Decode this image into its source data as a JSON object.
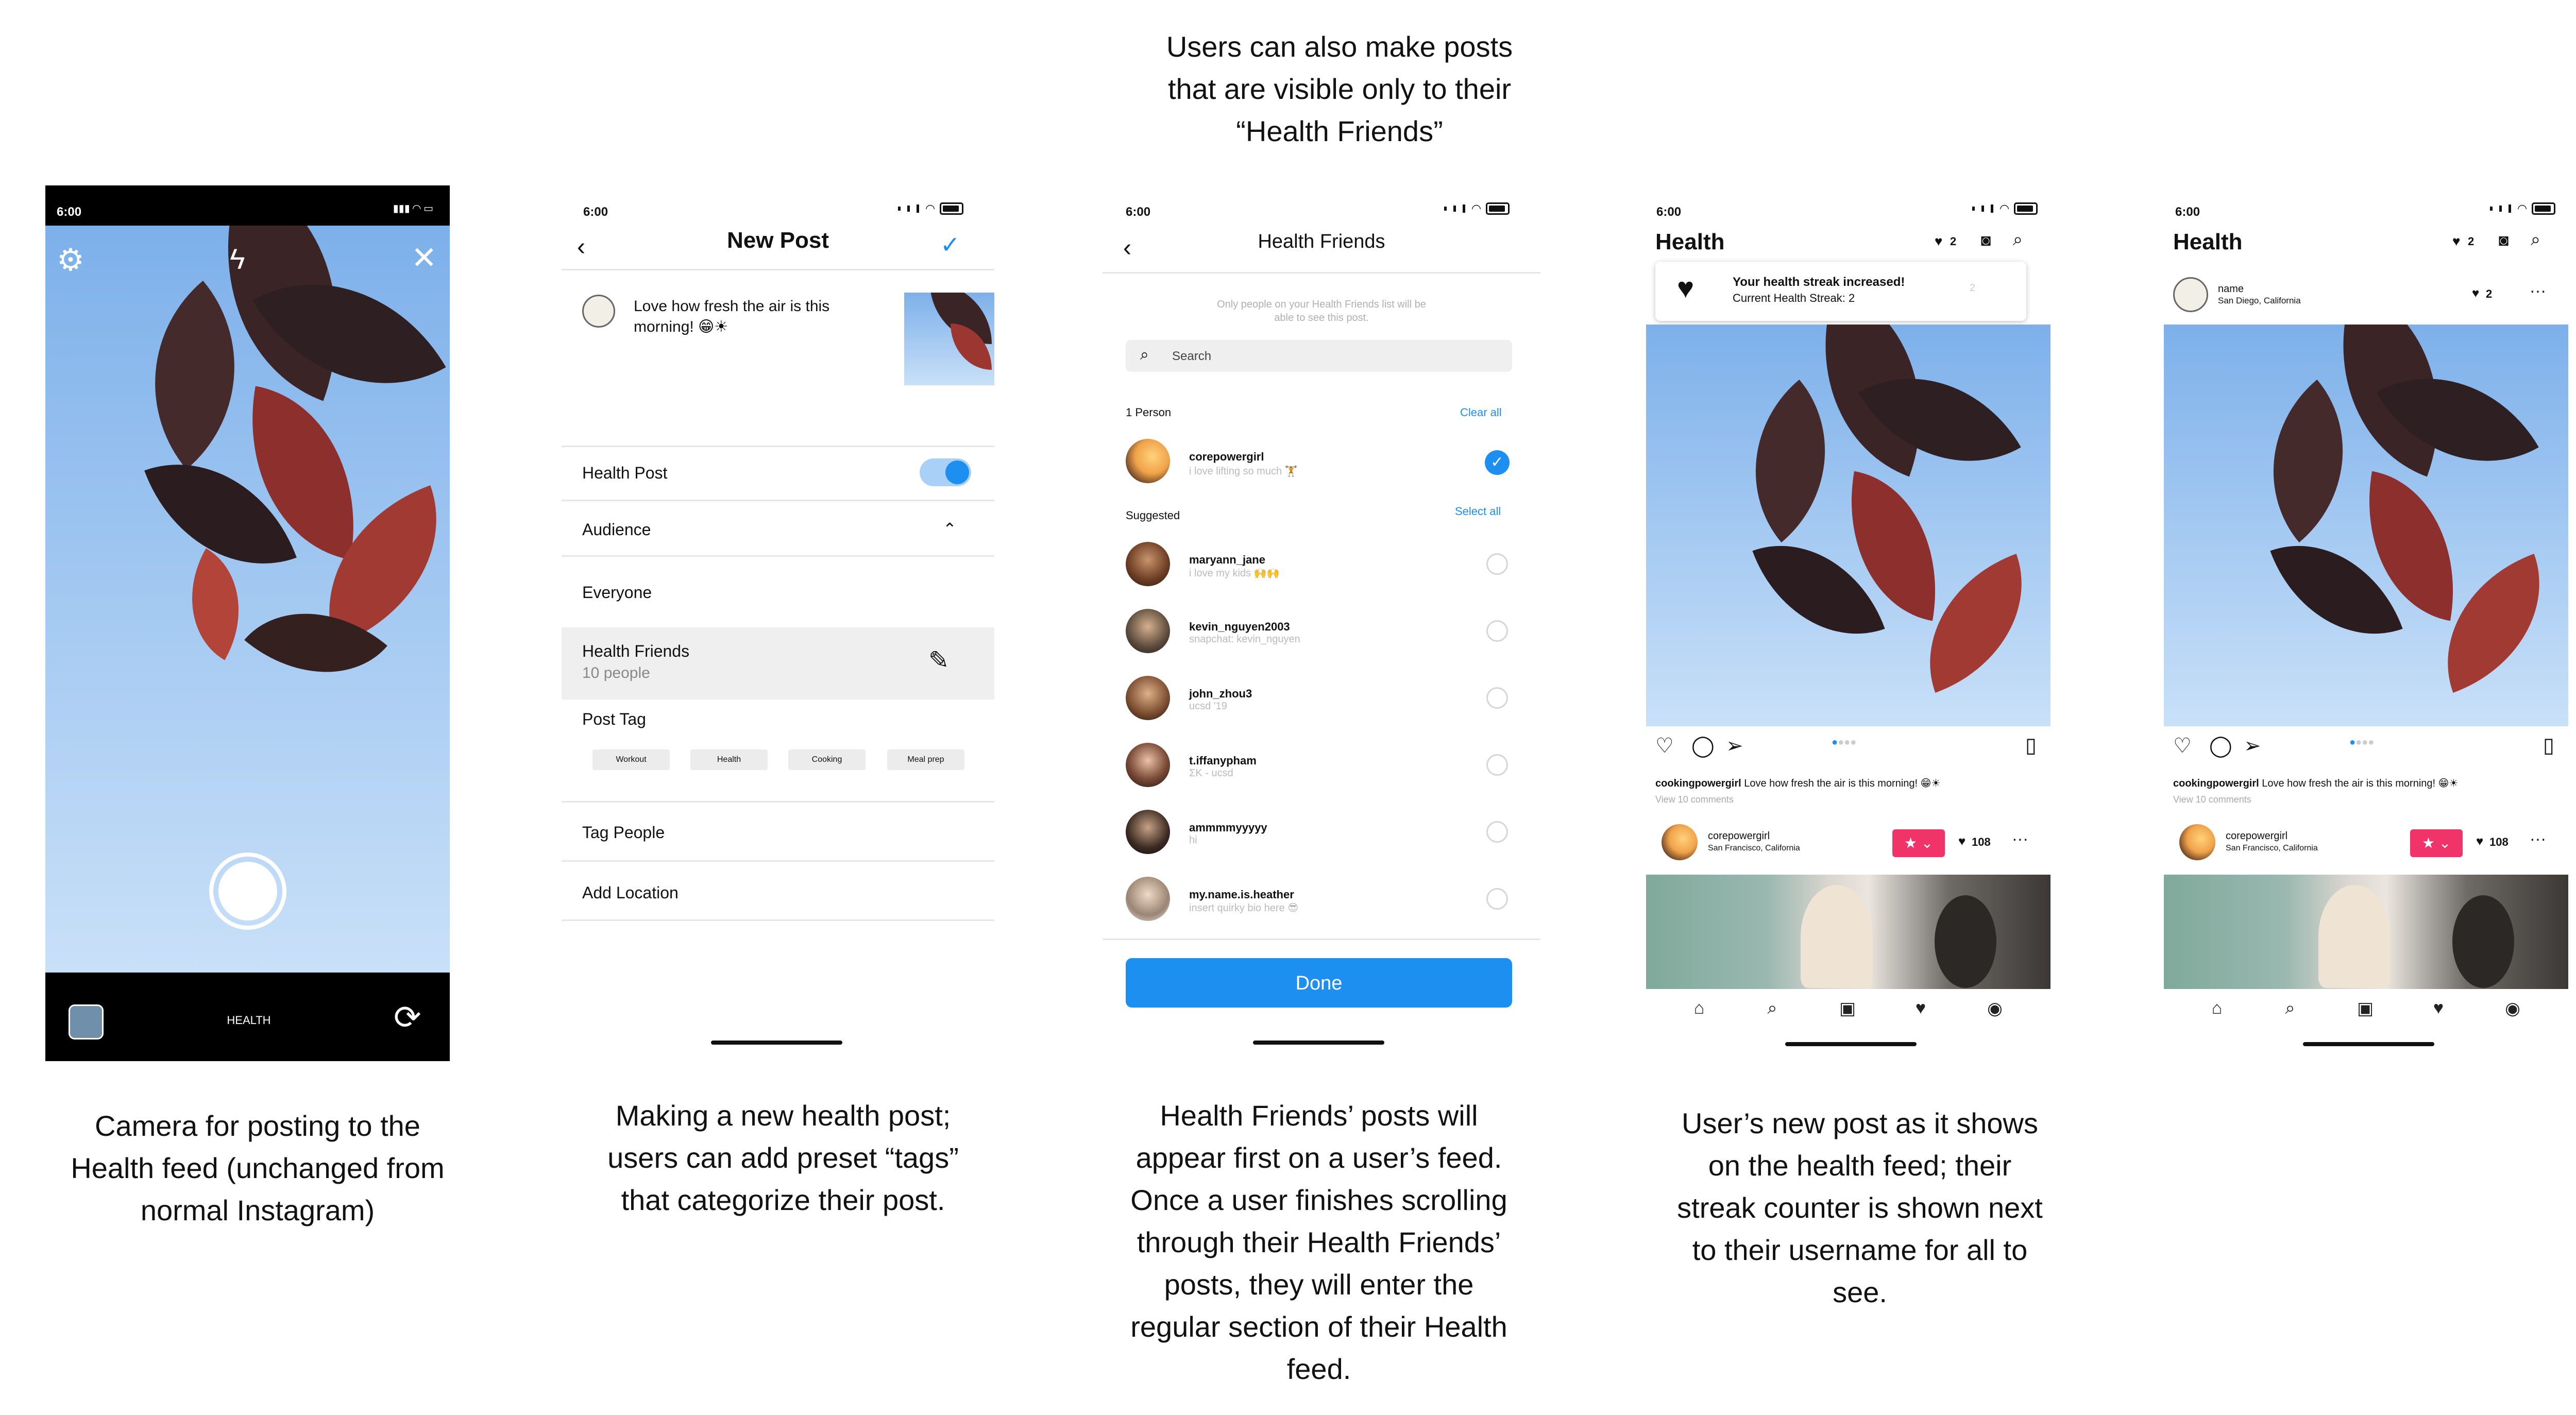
{
  "captions": {
    "top": "Users can also make posts\nthat are visible only to their\n“Health Friends”",
    "camera": "Camera for posting to the\nHealth feed (unchanged from\nnormal Instagram)",
    "new_post": "Making a new health post;\nusers can add preset “tags”\nthat categorize their post.",
    "health_friends": "Health Friends’ posts will\nappear first on a user’s feed.\nOnce a user finishes scrolling\nthrough their Health Friends’\nposts, they will enter the\nregular section of their Health\nfeed.",
    "feed": "User’s new post as it shows\non the health feed; their\nstreak counter is shown next\nto their username for all to\nsee."
  },
  "status_time": "6:00",
  "camera": {
    "mode_label": "HEALTH",
    "icons": [
      "gear-icon",
      "flash-off-icon",
      "close-icon",
      "gallery-icon",
      "flip-camera-icon"
    ]
  },
  "new_post": {
    "title": "New Post",
    "caption": "Love how fresh the air is this morning! 😁☀",
    "health_post_label": "Health Post",
    "audience_label": "Audience",
    "everyone_label": "Everyone",
    "health_friends_label": "Health Friends",
    "health_friends_count": "10 people",
    "post_tag_label": "Post Tag",
    "tags": [
      "Workout",
      "Health",
      "Cooking",
      "Meal prep"
    ],
    "tag_people_label": "Tag People",
    "add_location_label": "Add Location",
    "health_post_enabled": true
  },
  "health_friends": {
    "title": "Health Friends",
    "notice": "Only people on your Health Friends list will be\nable to see this post.",
    "search_placeholder": "Search",
    "selected_header": "1 Person",
    "clear_all": "Clear all",
    "suggested_header": "Suggested",
    "select_all": "Select all",
    "selected": [
      {
        "name": "corepowergirl",
        "sub": "i love lifting so much 🏋"
      }
    ],
    "suggested": [
      {
        "name": "maryann_jane",
        "sub": "i love my kids 🙌🙌"
      },
      {
        "name": "kevin_nguyen2003",
        "sub": "snapchat: kevin_nguyen"
      },
      {
        "name": "john_zhou3",
        "sub": "ucsd '19"
      },
      {
        "name": "t.iffanypham",
        "sub": "ΣK - ucsd"
      },
      {
        "name": "ammmmyyyyy",
        "sub": "hi"
      },
      {
        "name": "my.name.is.heather",
        "sub": "insert quirky bio here 😎"
      }
    ],
    "done_label": "Done",
    "accent": "#1d8ff0"
  },
  "feed1": {
    "title": "Health",
    "streak_count": "2",
    "notif_title": "Your health streak increased!",
    "notif_sub": "Current Health Streak: 2",
    "notif_count": "2",
    "post_user": "cookingpowergirl",
    "post_caption": "Love how fresh the air is this morning! 😁☀",
    "view_comments": "View 10 comments",
    "next_user": "corepowergirl",
    "next_location": "San Francisco, California",
    "next_streak": "108"
  },
  "feed2": {
    "title": "Health",
    "streak_count": "2",
    "author_name": "name",
    "author_location": "San Diego, California",
    "author_streak": "2",
    "more": "···",
    "post_user": "cookingpowergirl",
    "post_caption": "Love how fresh the air is this morning! 😁☀",
    "view_comments": "View 10 comments",
    "next_user": "corepowergirl",
    "next_location": "San Francisco, California",
    "next_streak": "108"
  },
  "colors": {
    "accent_blue": "#1d8ff0",
    "brand_pink": "#f0346a",
    "camera_bar": "#000000"
  }
}
